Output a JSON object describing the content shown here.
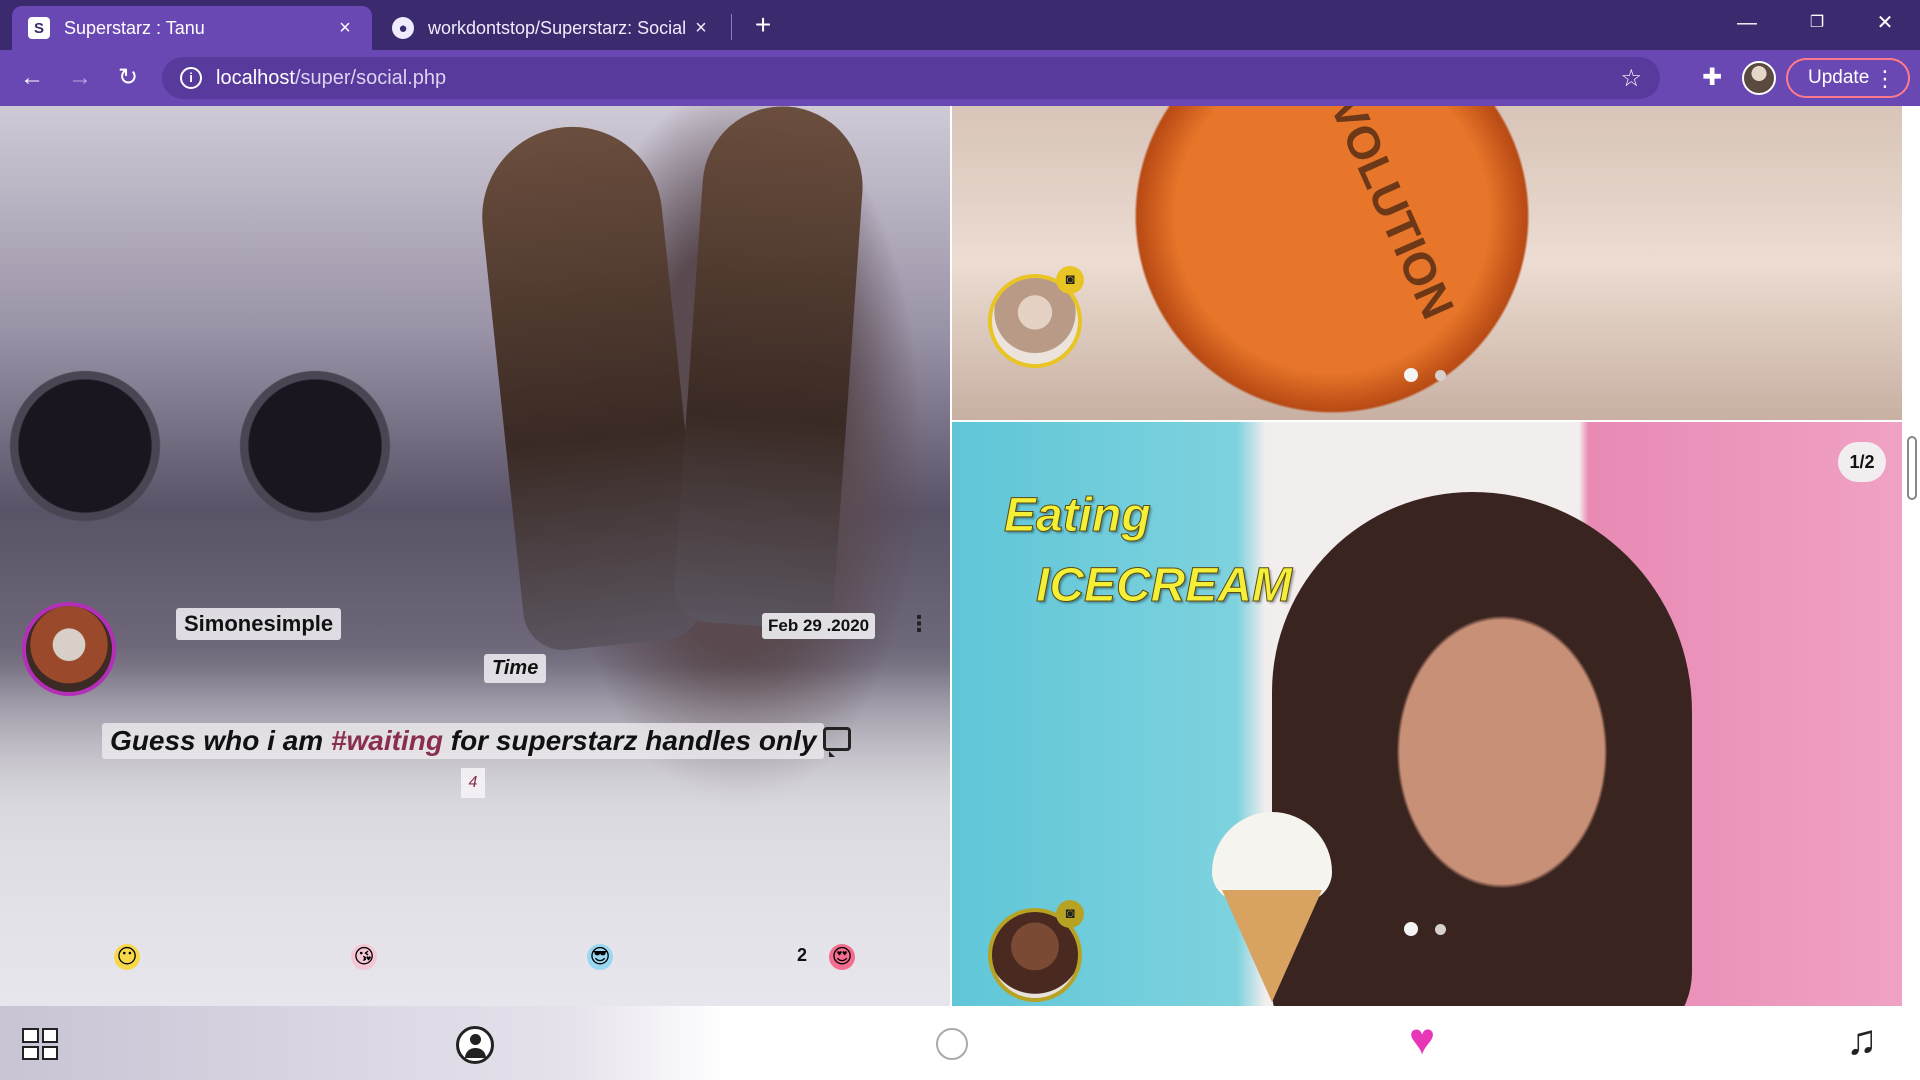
{
  "browser": {
    "tabs": [
      {
        "title": "Superstarz : Tanu",
        "favicon": "S",
        "active": true
      },
      {
        "title": "workdontstop/Superstarz: Social",
        "favicon": "github-icon",
        "active": false
      }
    ],
    "url_host": "localhost",
    "url_path": "/super/social.php",
    "update_label": "Update",
    "window_controls": {
      "minimize": "—",
      "restore": "❐",
      "close": "✕"
    }
  },
  "post_left": {
    "username": "Simonesimple",
    "date": "Feb 29 .2020",
    "time_label": "Time",
    "caption_before": "Guess who i am ",
    "caption_hashtag": "#waiting",
    "caption_after": " for superstarz handles only",
    "comment_count": "4",
    "reactions": [
      {
        "icon": "smile-emoji-icon",
        "glyph": "😶"
      },
      {
        "icon": "kiss-emoji-icon",
        "glyph": "😘"
      },
      {
        "icon": "cool-emoji-icon",
        "glyph": "😎"
      },
      {
        "icon": "heart-eyes-emoji-icon",
        "glyph": "😍",
        "count": "2"
      }
    ]
  },
  "post_right_top": {
    "ball_text": "EVOLUTION",
    "carousel_dots": 2,
    "active_dot": 0
  },
  "post_right_bottom": {
    "title_line1": "Eating",
    "title_line2": "ICECREAM",
    "page_counter": "1/2",
    "carousel_dots": 2,
    "active_dot": 0
  },
  "bottom_nav": {
    "items": [
      "grid-icon",
      "user-icon",
      "center-dot",
      "heart-icon",
      "music-icon"
    ],
    "heart_glyph": "♥",
    "music_glyph": "♫"
  },
  "colors": {
    "chrome_dark": "#3c2a6e",
    "chrome_light": "#6a48b4",
    "avatar_ring_left": "#b42fb8",
    "story_ring": "#e8c424",
    "hashtag": "#8a2e4e",
    "heart": "#e836b8",
    "title_yellow": "#f4f038"
  }
}
